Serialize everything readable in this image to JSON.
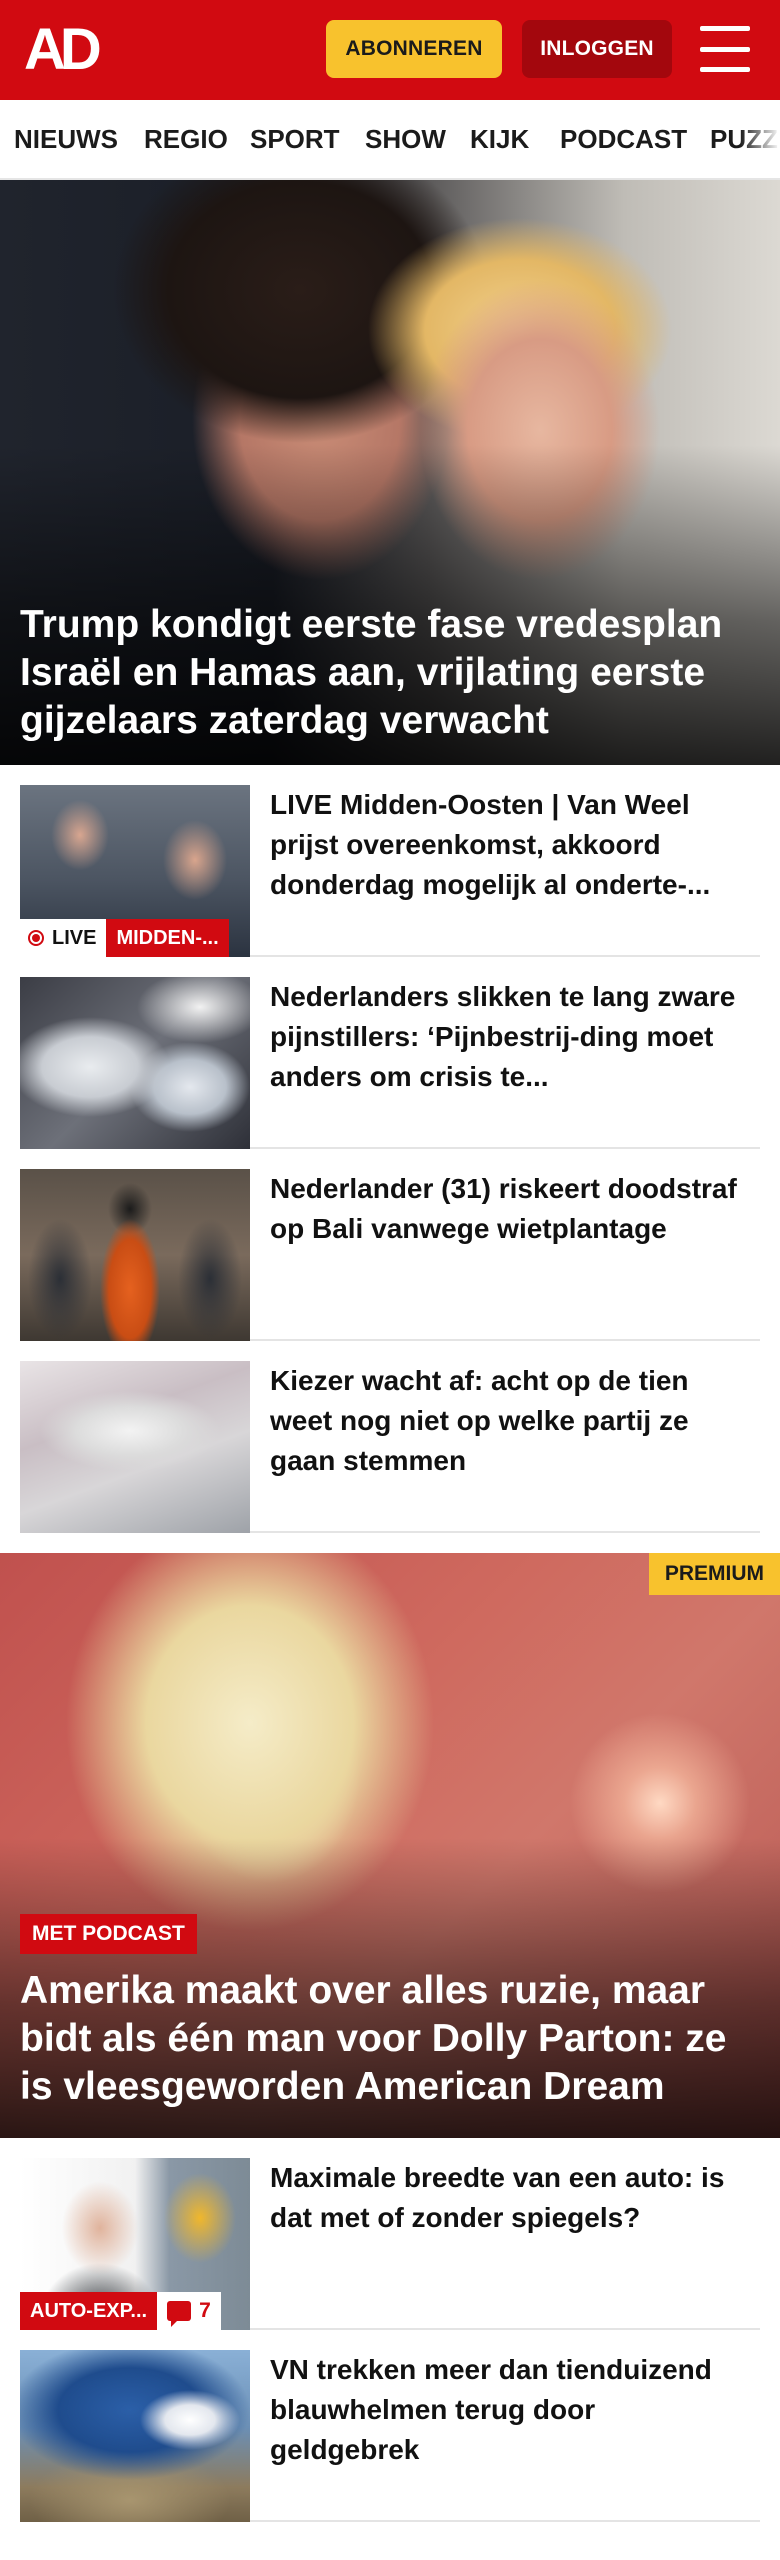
{
  "header": {
    "logo": "AD",
    "subscribe_label": "ABONNEREN",
    "login_label": "INLOGGEN"
  },
  "nav": {
    "items": [
      "NIEUWS",
      "REGIO",
      "SPORT",
      "SHOW",
      "KIJK",
      "PODCAST",
      "PUZZ"
    ]
  },
  "hero": {
    "title": "Trump kondigt eerste fase vredesplan Israël en Hamas aan, vrijlating eerste gijzelaars zaterdag verwacht"
  },
  "articles": [
    {
      "title": "LIVE Midden-Oosten | Van Weel prijst overeenkomst, akkoord donderdag mogelijk al onderte-...",
      "live_label": "LIVE",
      "category": "MIDDEN-..."
    },
    {
      "title": "Nederlanders slikken te lang zware pijnstillers: ‘Pijnbestrij-ding moet anders om crisis te..."
    },
    {
      "title": "Nederlander (31) riskeert doodstraf op Bali vanwege wietplantage"
    },
    {
      "title": "Kiezer wacht af: acht op de tien weet nog niet op welke partij ze gaan stemmen"
    }
  ],
  "feature": {
    "badge": "PREMIUM",
    "tag": "MET PODCAST",
    "title": "Amerika maakt over alles ruzie, maar bidt als één man voor Dolly Parton: ze is vleesgeworden American Dream"
  },
  "more_articles": [
    {
      "title": "Maximale breedte van een auto: is dat met of zonder spiegels?",
      "category": "AUTO-EXP...",
      "comments": "7"
    },
    {
      "title": "VN trekken meer dan tienduizend blauwhelmen terug door geldgebrek"
    }
  ]
}
